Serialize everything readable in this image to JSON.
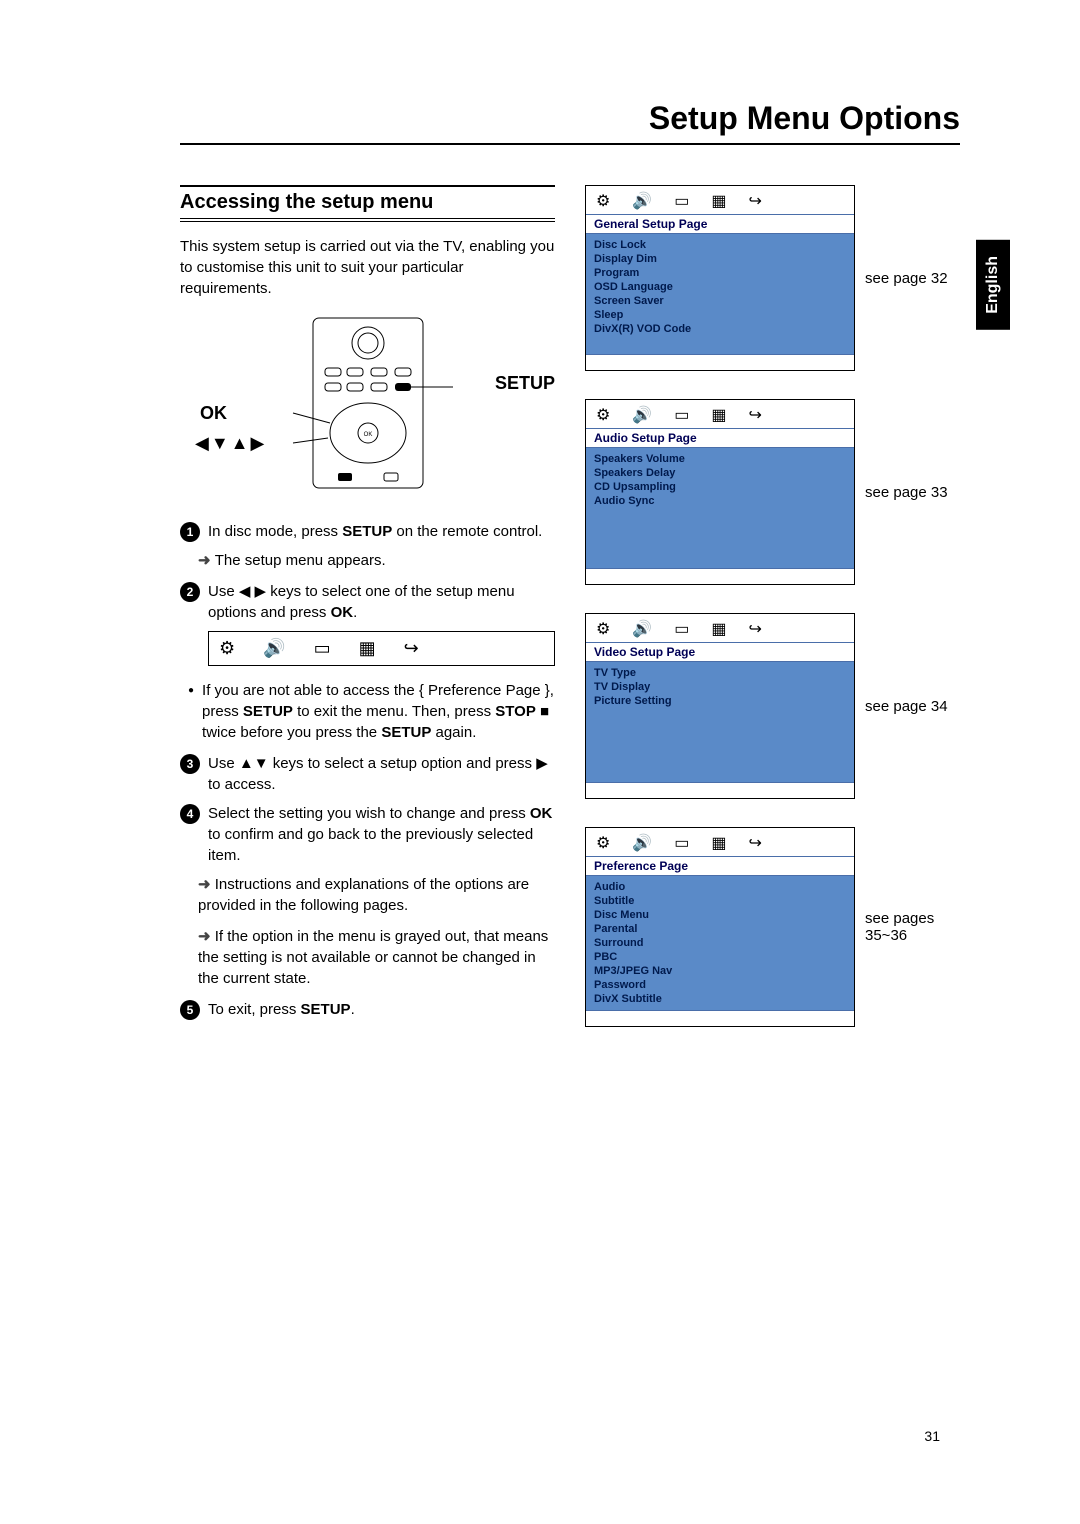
{
  "page_title": "Setup Menu Options",
  "section_title": "Accessing the setup menu",
  "intro": "This system setup is carried out via the TV, enabling you to customise this unit to suit your particular requirements.",
  "remote_labels": {
    "ok": "OK",
    "setup": "SETUP",
    "arrows": "◀▼▲▶"
  },
  "steps": {
    "s1_a": "In disc mode, press ",
    "s1_b": "SETUP",
    "s1_c": " on the remote control.",
    "s1_sub": "The setup menu appears.",
    "s2_a": "Use ◀ ▶ keys to select one of the setup menu options and press ",
    "s2_b": "OK",
    "s2_c": ".",
    "bullet_a": "If you are not able to access the { Preference Page }, press ",
    "bullet_b": "SETUP",
    "bullet_c": " to exit the menu. Then, press ",
    "bullet_d": "STOP",
    "bullet_e": " ■ twice before you press the ",
    "bullet_f": "SETUP",
    "bullet_g": " again.",
    "s3": "Use ▲▼ keys to select a setup option and press ▶ to access.",
    "s4_a": "Select the setting you wish to change and press ",
    "s4_b": "OK",
    "s4_c": " to confirm and go back to the previously selected item.",
    "s4_sub1": "Instructions and explanations of the options are provided in the following pages.",
    "s4_sub2": "If the option in the menu is grayed out, that means the setting is not available or cannot be changed in the current state.",
    "s5_a": "To exit, press ",
    "s5_b": "SETUP",
    "s5_c": "."
  },
  "osd_screens": [
    {
      "header": "General Setup Page",
      "items": [
        "Disc Lock",
        "Display Dim",
        "Program",
        "OSD Language",
        "Screen Saver",
        "Sleep",
        "DivX(R) VOD Code"
      ],
      "ref": "see page 32"
    },
    {
      "header": "Audio Setup Page",
      "items": [
        "Speakers Volume",
        "Speakers Delay",
        "CD Upsampling",
        "Audio Sync"
      ],
      "ref": "see page 33"
    },
    {
      "header": "Video Setup Page",
      "items": [
        "TV Type",
        "TV Display",
        "Picture Setting"
      ],
      "ref": "see page 34"
    },
    {
      "header": "Preference Page",
      "items": [
        "Audio",
        "Subtitle",
        "Disc Menu",
        "Parental",
        "Surround",
        "PBC",
        "MP3/JPEG Nav",
        "Password",
        "DivX Subtitle"
      ],
      "ref": "see pages 35~36"
    }
  ],
  "lang_tab": "English",
  "page_number": "31"
}
